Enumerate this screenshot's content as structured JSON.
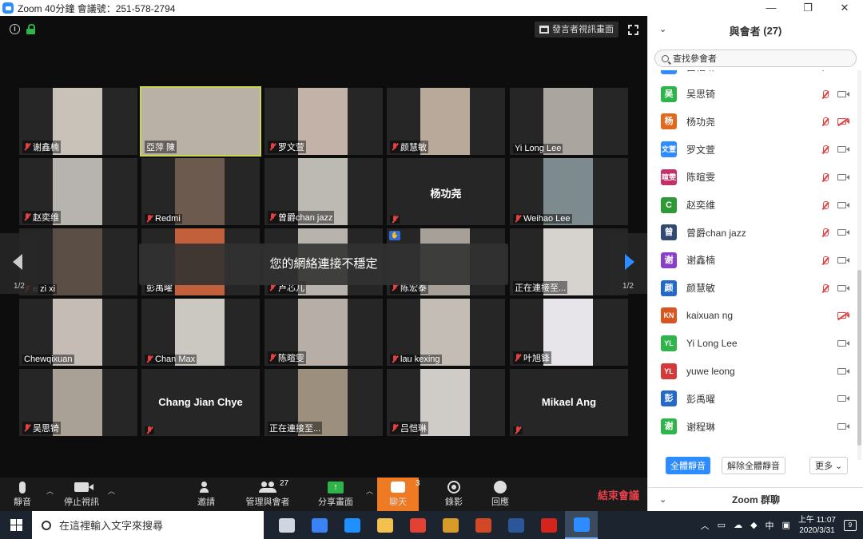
{
  "window": {
    "title": "Zoom 40分鐘 會議號：251-578-2794",
    "controls": [
      "—",
      "❐",
      "✕"
    ]
  },
  "stage": {
    "view_button_label": "發言者視訊畫面",
    "toast": "您的網絡連接不穩定",
    "page_left": "1/2",
    "page_right": "1/2"
  },
  "tiles": [
    {
      "name": "谢鑫楠",
      "video": true,
      "muted": true,
      "bg": "#c9c2b8"
    },
    {
      "name": "亞萍 陳",
      "video": true,
      "muted": false,
      "speaker": true,
      "bg": "#b9b0a6"
    },
    {
      "name": "罗文萱",
      "video": true,
      "muted": true,
      "bg": "#c3b2a8"
    },
    {
      "name": "颜慧敏",
      "video": true,
      "muted": true,
      "bg": "#b8a99a"
    },
    {
      "name": "Yi Long Lee",
      "video": true,
      "muted": false,
      "bg": "#aaa59e"
    },
    {
      "name": "赵奕维",
      "video": true,
      "muted": true,
      "bg": "#b7b4b0"
    },
    {
      "name": "Redmi",
      "video": true,
      "muted": true,
      "bg": "#6c5a4e"
    },
    {
      "name": "曾爵chan jazz",
      "video": true,
      "muted": true,
      "bg": "#bdbab3"
    },
    {
      "name": "杨功尧",
      "video": false,
      "muted": true,
      "center": "杨功尧"
    },
    {
      "name": "Weihao Lee",
      "video": true,
      "muted": true,
      "bg": "#7d8a8e"
    },
    {
      "name": "e zi xi",
      "video": true,
      "muted": true,
      "bg": "#5a4e45"
    },
    {
      "name": "彭禹曜",
      "video": true,
      "muted": false,
      "bg": "#c2603b"
    },
    {
      "name": "卢芯儿",
      "video": true,
      "muted": true,
      "bg": "#b9b3ad"
    },
    {
      "name": "陈宏泰",
      "video": true,
      "muted": true,
      "hand": true,
      "bg": "#a6a098"
    },
    {
      "name": "正在連接至...",
      "video": true,
      "muted": false,
      "bg": "#d6d3cf"
    },
    {
      "name": "Chewqixuan",
      "video": true,
      "muted": false,
      "bg": "#c5bcb6"
    },
    {
      "name": "Chan Max",
      "video": true,
      "muted": true,
      "bg": "#cbc8c2"
    },
    {
      "name": "陈暄雯",
      "video": true,
      "muted": true,
      "bg": "#b7afa7"
    },
    {
      "name": "lau kexing",
      "video": true,
      "muted": true,
      "bg": "#c4bdb5"
    },
    {
      "name": "叶旭锋",
      "video": true,
      "muted": true,
      "bg": "#e7e4ea"
    },
    {
      "name": "吴思锜",
      "video": true,
      "muted": true,
      "bg": "#a9a096"
    },
    {
      "name": "Chang Jian Chye",
      "video": false,
      "muted": true,
      "center": "Chang Jian Chye"
    },
    {
      "name": "正在連接至...",
      "video": true,
      "muted": false,
      "bg": "#9c8f7e"
    },
    {
      "name": "吕恺琳",
      "video": true,
      "muted": true,
      "bg": "#cfcbc6"
    },
    {
      "name": "Mikael Ang",
      "video": false,
      "muted": true,
      "center": "Mikael Ang"
    }
  ],
  "toolbar": {
    "mute_label": "靜音",
    "stop_video_label": "停止視訊",
    "invite_label": "邀請",
    "participants_label": "管理與會者",
    "participants_count": "27",
    "share_label": "分享畫面",
    "chat_label": "聊天",
    "chat_count": "3",
    "record_label": "錄影",
    "reactions_label": "回應",
    "end_label": "結束會議"
  },
  "panel": {
    "title": "與會者",
    "count": "(27)",
    "search_placeholder": "查找參會者",
    "participants": [
      {
        "avatar": "吕",
        "name": "吕恺琳",
        "color": "#2d8cff",
        "muted": true,
        "cam_off": false
      },
      {
        "avatar": "吴",
        "name": "吴思锜",
        "color": "#2fb44a",
        "muted": true,
        "cam_off": false
      },
      {
        "avatar": "杨",
        "name": "杨功尧",
        "color": "#e3671c",
        "muted": true,
        "cam_off": true
      },
      {
        "avatar": "文萱",
        "name": "罗文萱",
        "color": "#2d8cff",
        "muted": true,
        "cam_off": false
      },
      {
        "avatar": "暄雯",
        "name": "陈暄雯",
        "color": "#c4306a",
        "muted": true,
        "cam_off": false
      },
      {
        "avatar": "C",
        "name": "赵奕维",
        "color": "#2e9a36",
        "muted": true,
        "cam_off": false
      },
      {
        "avatar": "曾",
        "name": "曾爵chan jazz",
        "color": "#304a73",
        "muted": true,
        "cam_off": false
      },
      {
        "avatar": "谢",
        "name": "谢鑫楠",
        "color": "#8a3fc8",
        "muted": true,
        "cam_off": false
      },
      {
        "avatar": "颜",
        "name": "颜慧敏",
        "color": "#2269c9",
        "muted": true,
        "cam_off": false
      },
      {
        "avatar": "KN",
        "name": "kaixuan ng",
        "color": "#d9541e",
        "muted": false,
        "cam_off": true
      },
      {
        "avatar": "YL",
        "name": "Yi Long Lee",
        "color": "#2fb44a",
        "muted": false,
        "cam_off": false
      },
      {
        "avatar": "YL",
        "name": "yuwe leong",
        "color": "#d33a3a",
        "muted": false,
        "cam_off": false
      },
      {
        "avatar": "彭",
        "name": "彭禹曜",
        "color": "#2269c9",
        "muted": false,
        "cam_off": false
      },
      {
        "avatar": "谢",
        "name": "谢程琳",
        "color": "#2fb44a",
        "muted": false,
        "cam_off": false
      }
    ],
    "mute_all_label": "全體靜音",
    "unmute_all_label": "解除全體靜音",
    "more_label": "更多 ⌄",
    "chat_title": "Zoom 群聊"
  },
  "taskbar": {
    "search_placeholder": "在這裡輸入文字來搜尋",
    "time": "上午 11:07",
    "date": "2020/3/31",
    "ime": "中",
    "notif_count": "9",
    "apps": [
      {
        "name": "task-view-icon",
        "color": "#cfd6df"
      },
      {
        "name": "store-icon",
        "color": "#3b82f6"
      },
      {
        "name": "edge-icon",
        "color": "#1e90ff"
      },
      {
        "name": "file-explorer-icon",
        "color": "#f2c14e"
      },
      {
        "name": "chrome-icon",
        "color": "#e34133"
      },
      {
        "name": "app-icon",
        "color": "#d89b2a"
      },
      {
        "name": "powerpoint-icon",
        "color": "#d24726"
      },
      {
        "name": "word-icon",
        "color": "#2b579a"
      },
      {
        "name": "acrobat-icon",
        "color": "#d4241c"
      },
      {
        "name": "zoom-icon",
        "color": "#2d8cff"
      }
    ]
  }
}
